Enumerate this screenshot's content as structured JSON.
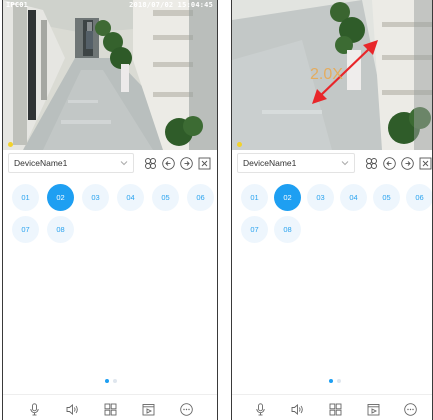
{
  "panels": [
    {
      "id": "left",
      "osd_channel": "IPC01",
      "osd_time": "2018/07/02 15:04:45",
      "device_name": "DeviceName1",
      "channels": [
        "01",
        "02",
        "03",
        "04",
        "05",
        "06",
        "07",
        "08"
      ],
      "selected_channel": "02"
    },
    {
      "id": "right",
      "zoom_label": "2.0X",
      "device_name": "DeviceName1",
      "channels": [
        "01",
        "02",
        "03",
        "04",
        "05",
        "06",
        "07",
        "08"
      ],
      "selected_channel": "02"
    }
  ],
  "colors": {
    "accent": "#1e9ff2",
    "channel_bg": "#eef6fd",
    "channel_text": "#2aa3ef",
    "zoom_arrow": "#e8262a",
    "rec_indicator": "#f2d22a"
  },
  "toolbar_icons": [
    "ptz-icon",
    "arrow-left-circle-icon",
    "arrow-right-circle-icon",
    "close-window-icon"
  ],
  "bottom_icons": [
    "microphone-icon",
    "speaker-icon",
    "grid-layout-icon",
    "playback-icon",
    "more-icon"
  ],
  "pagination": {
    "pages": 2,
    "current": 1
  }
}
